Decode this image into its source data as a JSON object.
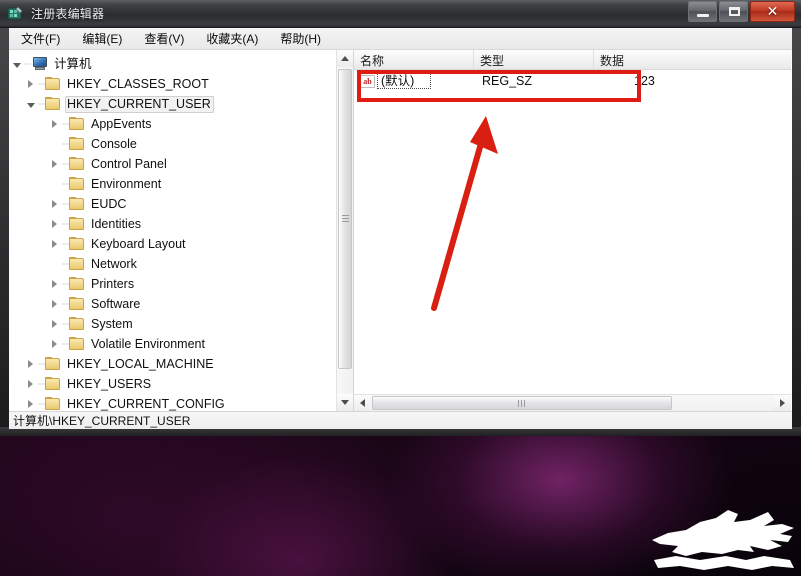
{
  "window": {
    "title": "注册表编辑器",
    "icon": "regedit-icon",
    "controls": {
      "minimize": "minimize-icon",
      "maximize": "maximize-icon",
      "close": "✕"
    }
  },
  "menubar": {
    "items": [
      {
        "label": "文件(F)",
        "name": "menu-file"
      },
      {
        "label": "编辑(E)",
        "name": "menu-edit"
      },
      {
        "label": "查看(V)",
        "name": "menu-view"
      },
      {
        "label": "收藏夹(A)",
        "name": "menu-favorites"
      },
      {
        "label": "帮助(H)",
        "name": "menu-help"
      }
    ]
  },
  "tree": {
    "rows": [
      {
        "label": "计算机",
        "indent": 0,
        "expander": "expanded",
        "icon": "computer-icon",
        "selected": false
      },
      {
        "label": "HKEY_CLASSES_ROOT",
        "indent": 1,
        "expander": "collapsed",
        "icon": "folder-icon",
        "selected": false
      },
      {
        "label": "HKEY_CURRENT_USER",
        "indent": 1,
        "expander": "expanded",
        "icon": "folder-icon",
        "selected": true
      },
      {
        "label": "AppEvents",
        "indent": 2,
        "expander": "collapsed",
        "icon": "folder-icon",
        "selected": false
      },
      {
        "label": "Console",
        "indent": 2,
        "expander": "none",
        "icon": "folder-icon",
        "selected": false
      },
      {
        "label": "Control Panel",
        "indent": 2,
        "expander": "collapsed",
        "icon": "folder-icon",
        "selected": false
      },
      {
        "label": "Environment",
        "indent": 2,
        "expander": "none",
        "icon": "folder-icon",
        "selected": false
      },
      {
        "label": "EUDC",
        "indent": 2,
        "expander": "collapsed",
        "icon": "folder-icon",
        "selected": false
      },
      {
        "label": "Identities",
        "indent": 2,
        "expander": "collapsed",
        "icon": "folder-icon",
        "selected": false
      },
      {
        "label": "Keyboard Layout",
        "indent": 2,
        "expander": "collapsed",
        "icon": "folder-icon",
        "selected": false
      },
      {
        "label": "Network",
        "indent": 2,
        "expander": "none",
        "icon": "folder-icon",
        "selected": false
      },
      {
        "label": "Printers",
        "indent": 2,
        "expander": "collapsed",
        "icon": "folder-icon",
        "selected": false
      },
      {
        "label": "Software",
        "indent": 2,
        "expander": "collapsed",
        "icon": "folder-icon",
        "selected": false
      },
      {
        "label": "System",
        "indent": 2,
        "expander": "collapsed",
        "icon": "folder-icon",
        "selected": false
      },
      {
        "label": "Volatile Environment",
        "indent": 2,
        "expander": "collapsed",
        "icon": "folder-icon",
        "selected": false
      },
      {
        "label": "HKEY_LOCAL_MACHINE",
        "indent": 1,
        "expander": "collapsed",
        "icon": "folder-icon",
        "selected": false
      },
      {
        "label": "HKEY_USERS",
        "indent": 1,
        "expander": "collapsed",
        "icon": "folder-icon",
        "selected": false
      },
      {
        "label": "HKEY_CURRENT_CONFIG",
        "indent": 1,
        "expander": "collapsed",
        "icon": "folder-icon",
        "selected": false
      }
    ]
  },
  "list": {
    "columns": [
      {
        "label": "名称",
        "name": "column-name"
      },
      {
        "label": "类型",
        "name": "column-type"
      },
      {
        "label": "数据",
        "name": "column-data"
      }
    ],
    "rows": [
      {
        "name": "(默认)",
        "type": "REG_SZ",
        "data": "123",
        "icon": "ab-string-icon",
        "icon_text": "ab",
        "focused": true
      }
    ]
  },
  "statusbar": {
    "path": "计算机\\HKEY_CURRENT_USER"
  },
  "annotations": {
    "highlight_box": {
      "color": "#e01b12"
    },
    "arrow": {
      "color": "#d81f12"
    }
  }
}
